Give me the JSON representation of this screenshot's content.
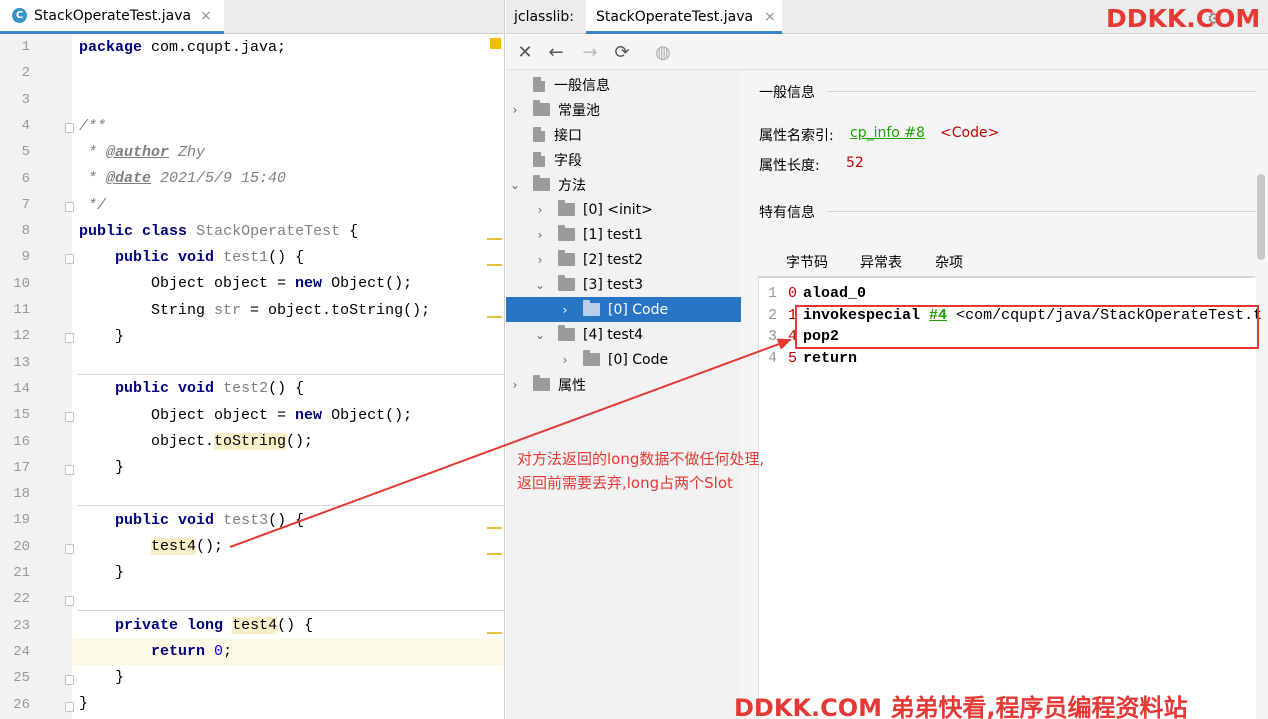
{
  "editor": {
    "tab_title": "StackOperateTest.java",
    "tab_icon_letter": "C",
    "close_glyph": "×",
    "line_numbers": [
      "1",
      "2",
      "3",
      "4",
      "5",
      "6",
      "7",
      "8",
      "9",
      "10",
      "11",
      "12",
      "13",
      "14",
      "15",
      "16",
      "17",
      "18",
      "19",
      "20",
      "21",
      "22",
      "23",
      "24",
      "25",
      "26"
    ],
    "code": {
      "package_kw": "package",
      "package_name": " com.cqupt.java;",
      "doc_open": "/**",
      "author_star": " * ",
      "author_tag": "@author",
      "author_value": " Zhy",
      "date_star": " * ",
      "date_tag": "@date",
      "date_value": " 2021/5/9 15:40",
      "doc_close": " */",
      "public_kw": "public",
      "class_kw": "class",
      "class_name": "StackOperateTest",
      "brace_open": "{",
      "void_kw": "void",
      "test1_name": "test1",
      "parens_brace": "() {",
      "object_line_start": "Object object = ",
      "new_kw": "new",
      "object_line_end": " Object();",
      "string_type": "String ",
      "str_var": "str",
      "string_line_end": " = object.toString();",
      "brace_close": "}",
      "test2_name": "test2",
      "object_dot": "object.",
      "to_string": "toString",
      "call_end": "();",
      "test3_name": "test3",
      "test4_call": "test4",
      "private_kw": "private",
      "long_kw": "long",
      "test4_name": "test4",
      "return_kw": "return",
      "zero": "0",
      "semicolon": ";"
    }
  },
  "jclasslib": {
    "label": "jclasslib:",
    "tab_title": "StackOperateTest.java",
    "close_glyph": "×",
    "toolbar": {
      "close_icon": "✕",
      "back_icon": "←",
      "forward_icon": "→",
      "refresh_icon": "⟳",
      "web_icon": "◍"
    },
    "tree": [
      {
        "label": "一般信息",
        "icon": "file-icon",
        "chevron": ""
      },
      {
        "label": "常量池",
        "icon": "folder-icon",
        "chevron": "›"
      },
      {
        "label": "接口",
        "icon": "file-icon",
        "chevron": ""
      },
      {
        "label": "字段",
        "icon": "file-icon",
        "chevron": ""
      },
      {
        "label": "方法",
        "icon": "folder-icon",
        "chevron": "⌄"
      },
      {
        "label": "[0] <init>",
        "icon": "folder-icon",
        "chevron": "›"
      },
      {
        "label": "[1] test1",
        "icon": "folder-icon",
        "chevron": "›"
      },
      {
        "label": "[2] test2",
        "icon": "folder-icon",
        "chevron": "›"
      },
      {
        "label": "[3] test3",
        "icon": "folder-icon",
        "chevron": "⌄"
      },
      {
        "label": "[0] Code",
        "icon": "folder-icon",
        "chevron": "›"
      },
      {
        "label": "[4] test4",
        "icon": "folder-icon",
        "chevron": "⌄"
      },
      {
        "label": "[0] Code",
        "icon": "folder-icon",
        "chevron": "›"
      },
      {
        "label": "属性",
        "icon": "folder-icon",
        "chevron": "›"
      }
    ],
    "detail": {
      "general_title": "一般信息",
      "attr_name_label": "属性名索引:",
      "attr_name_link": "cp_info #8",
      "attr_name_value": "<Code>",
      "attr_len_label": "属性长度:",
      "attr_len_value": "52",
      "specific_title": "特有信息",
      "tabs": [
        "字节码",
        "异常表",
        "杂项"
      ],
      "bytecode": [
        {
          "line": "1",
          "offset": "0",
          "op": "aload_0",
          "ref": "",
          "rest": ""
        },
        {
          "line": "2",
          "offset": "1",
          "op": "invokespecial",
          "ref": "#4",
          "rest": " <com/cqupt/java/StackOperateTest.t"
        },
        {
          "line": "3",
          "offset": "4",
          "op": "pop2",
          "ref": "",
          "rest": ""
        },
        {
          "line": "4",
          "offset": "5",
          "op": "return",
          "ref": "",
          "rest": ""
        }
      ]
    }
  },
  "annotation": {
    "line1": "对方法返回的long数据不做任何处理,",
    "line2": "返回前需要丢弃,long占两个Slot",
    "color": "#e53935"
  },
  "watermark": {
    "top": "DDKK.COM",
    "bottom": "DDKK.COM 弟弟快看,程序员编程资料站"
  }
}
